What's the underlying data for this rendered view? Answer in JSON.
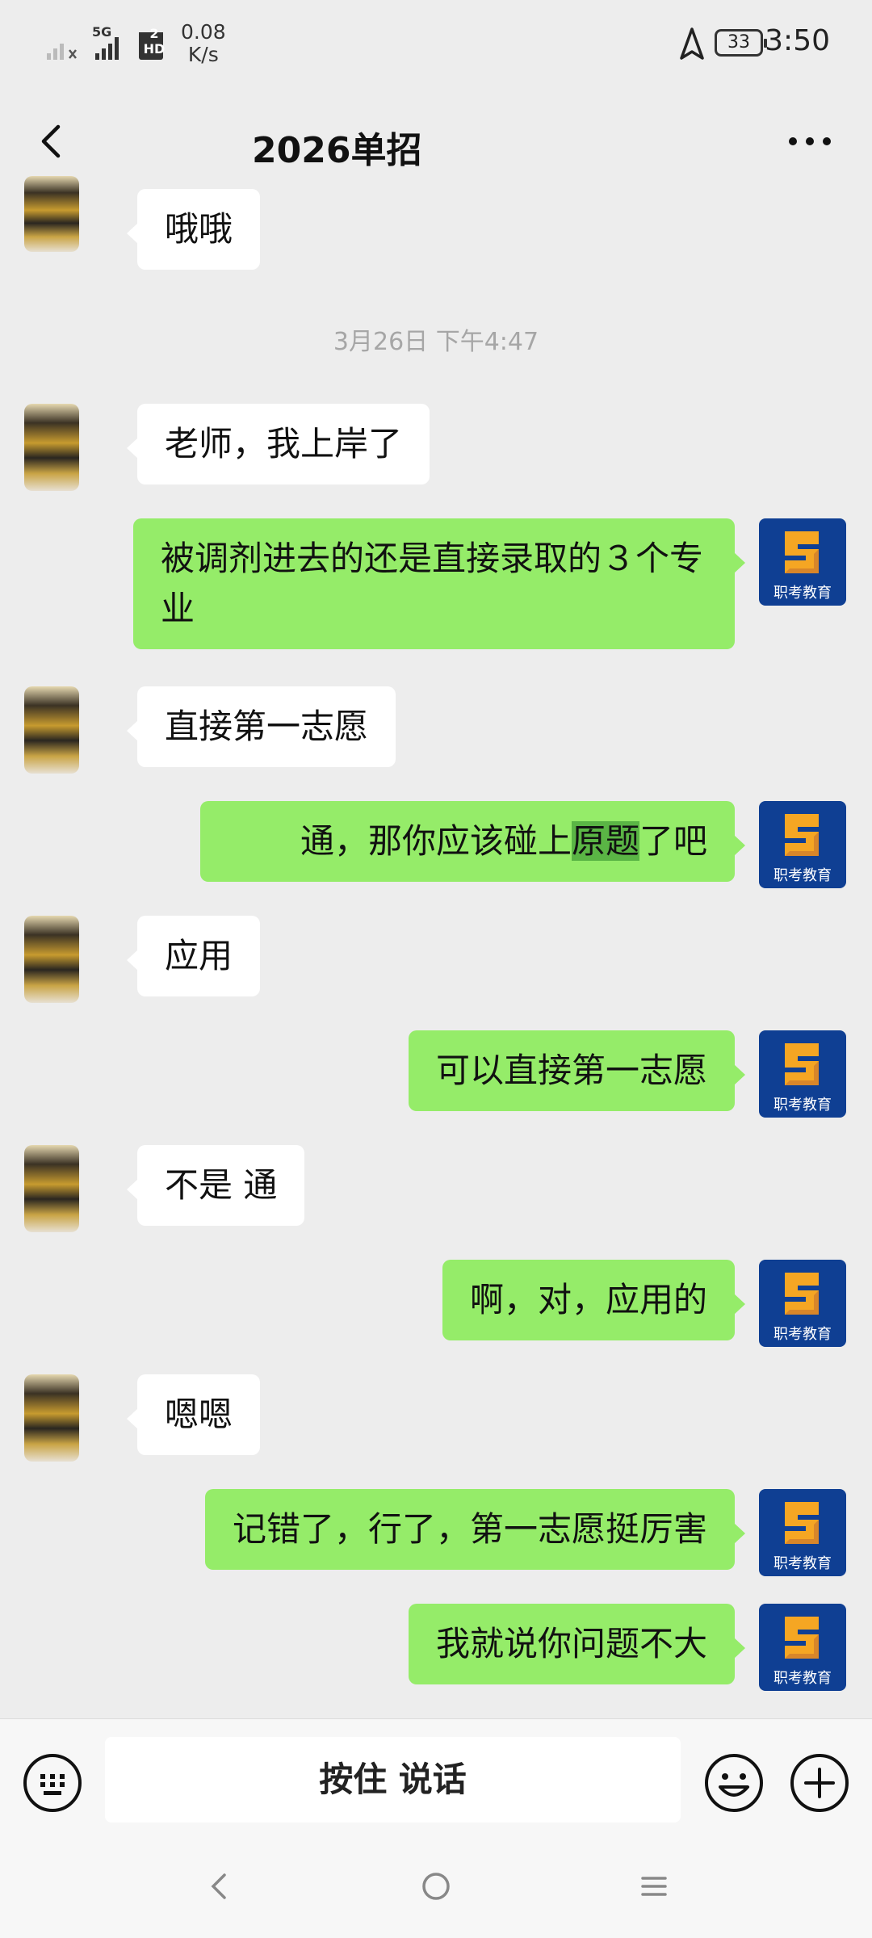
{
  "status_bar": {
    "network": "5G",
    "sim2": "2",
    "hd": "HD",
    "speed_value": "0.08",
    "speed_unit": "K/s",
    "battery": "33",
    "time": "3:50"
  },
  "header": {
    "title": "2026单招"
  },
  "messages": [
    {
      "side": "left",
      "text": "哦哦"
    },
    {
      "side": "left",
      "text": "老师，我上岸了"
    },
    {
      "side": "right",
      "text": "被调剂进去的还是直接录取的３个专业"
    },
    {
      "side": "left",
      "text": "直接第一志愿"
    },
    {
      "side": "right",
      "text_pre": "通，那你应该碰上",
      "text_highlight": "原题",
      "text_post": "了吧"
    },
    {
      "side": "left",
      "text": "应用"
    },
    {
      "side": "right",
      "text": "可以直接第一志愿"
    },
    {
      "side": "left",
      "text": "不是 通"
    },
    {
      "side": "right",
      "text": "啊，对，应用的"
    },
    {
      "side": "left",
      "text": "嗯嗯"
    },
    {
      "side": "right",
      "text": "记错了，行了，第一志愿挺厉害"
    },
    {
      "side": "right",
      "text": "我就说你问题不大"
    }
  ],
  "timestamp": "3月26日 下午4:47",
  "teacher_avatar_label": "职考教育",
  "input_bar": {
    "talk_label": "按住 说话",
    "keyboard_icon": "keyboard-icon",
    "emoji_icon": "emoji-icon",
    "plus_icon": "plus-icon"
  },
  "colors": {
    "sent_bubble": "#95ec69",
    "received_bubble": "#ffffff",
    "background": "#ededed",
    "avatar_brand": "#0f3f93"
  }
}
